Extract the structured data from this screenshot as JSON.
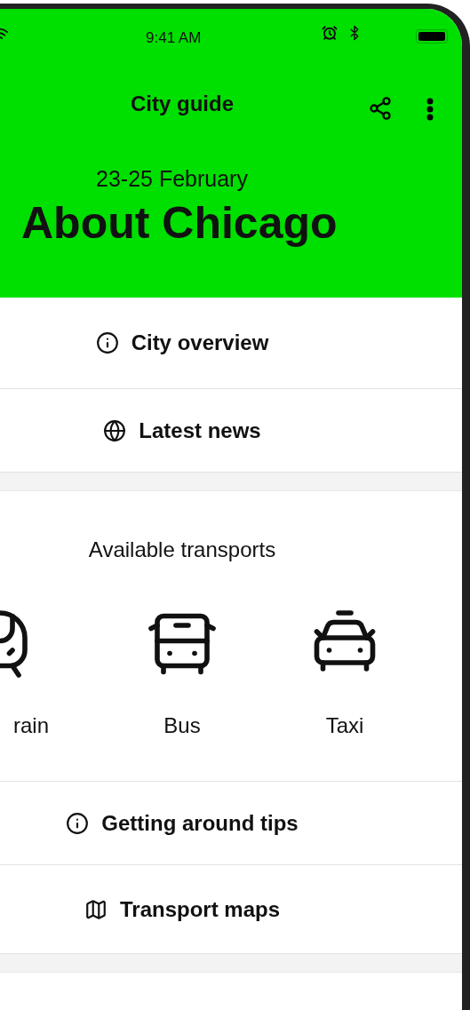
{
  "status_bar": {
    "time": "9:41 AM"
  },
  "app_bar": {
    "title": "City guide"
  },
  "hero": {
    "dates": "23-25 February",
    "title": "About Chicago"
  },
  "links": [
    {
      "label": "City overview",
      "kind": "info"
    },
    {
      "label": "Latest news",
      "kind": "globe"
    }
  ],
  "transports": {
    "heading": "Available transports",
    "items": [
      {
        "label": "rain",
        "kind": "train"
      },
      {
        "label": "Bus",
        "kind": "bus"
      },
      {
        "label": "Taxi",
        "kind": "taxi"
      }
    ]
  },
  "more_links": [
    {
      "label": "Getting around tips",
      "kind": "info"
    },
    {
      "label": "Transport maps",
      "kind": "map"
    }
  ]
}
